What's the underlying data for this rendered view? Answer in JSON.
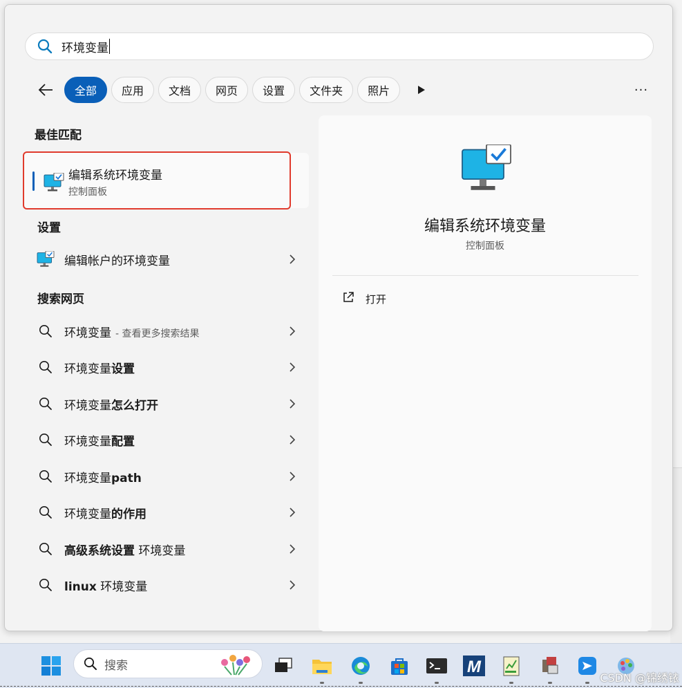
{
  "search": {
    "query": "环境变量"
  },
  "filters": {
    "chips": [
      "全部",
      "应用",
      "文档",
      "网页",
      "设置",
      "文件夹",
      "照片"
    ],
    "active": "全部",
    "more": "···"
  },
  "best_match": {
    "section": "最佳匹配",
    "title": "编辑系统环境变量",
    "subtitle": "控制面板"
  },
  "settings": {
    "section": "设置",
    "item": "编辑帐户的环境变量"
  },
  "web": {
    "section": "搜索网页",
    "items": [
      {
        "normal": "环境变量",
        "bold": "",
        "hint": "- 查看更多搜索结果"
      },
      {
        "normal": "环境变量",
        "bold": "设置",
        "hint": ""
      },
      {
        "normal": "环境变量",
        "bold": "怎么打开",
        "hint": ""
      },
      {
        "normal": "环境变量",
        "bold": "配置",
        "hint": ""
      },
      {
        "normal": "环境变量",
        "bold": "path",
        "hint": ""
      },
      {
        "normal": "环境变量",
        "bold": "的作用",
        "hint": ""
      },
      {
        "bold_first": "高级系统设置",
        "normal_after": " 环境变量"
      },
      {
        "bold_first": "linux",
        "normal_after": " 环境变量"
      }
    ]
  },
  "detail": {
    "title": "编辑系统环境变量",
    "subtitle": "控制面板",
    "action_open": "打开"
  },
  "taskbar": {
    "search_label": "搜索",
    "watermark": "CSDN @锦绣铱",
    "apps": [
      "start-icon",
      "task-view-icon",
      "file-explorer-icon",
      "edge-icon",
      "store-icon",
      "terminal-icon",
      "m-app-icon",
      "notepad-icon",
      "app-icon",
      "lark-icon",
      "paint-icon"
    ]
  },
  "colors": {
    "accent": "#0a5fb8",
    "highlight_frame": "#e03a2c"
  }
}
